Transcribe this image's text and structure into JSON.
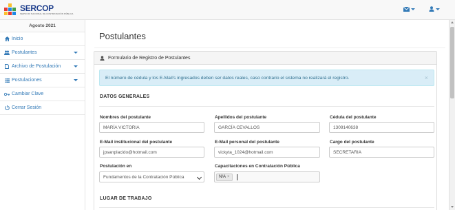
{
  "brand": {
    "title": "SERCOP",
    "subtitle": "SERVICIO NACIONAL DE CONTRATACIÓN PÚBLICA",
    "colors": [
      "#e53935",
      "#fbc02d",
      "#1e88e5",
      "#43a047"
    ]
  },
  "navbar": {
    "mail_icon": "envelope-icon",
    "user_icon": "user-icon"
  },
  "sidebar": {
    "date": "Agosto 2021",
    "items": [
      {
        "label": "Inicio",
        "icon": "home-icon",
        "has_arrow": false
      },
      {
        "label": "Postulantes",
        "icon": "users-icon",
        "has_arrow": true
      },
      {
        "label": "Archivo de Postulación",
        "icon": "file-icon",
        "has_arrow": true
      },
      {
        "label": "Postulaciones",
        "icon": "list-icon",
        "has_arrow": true
      },
      {
        "label": "Cambiar Clave",
        "icon": "key-icon",
        "has_arrow": false
      },
      {
        "label": "Cerrar Sesión",
        "icon": "power-icon",
        "has_arrow": false
      }
    ]
  },
  "main": {
    "title": "Postulantes",
    "panel_title": "Formulario de Registro de Postulantes",
    "alert": "El número de cédula y los E-Mail's ingresados deben ser datos reales, caso contrario el sistema no realizará el registro.",
    "alert_close": "×",
    "section_general": "DATOS GENERALES",
    "section_work": "LUGAR DE TRABAJO",
    "fields": {
      "nombres_label": "Nombres del postulante",
      "nombres_value": "MARÍA VICTORIA",
      "apellidos_label": "Apellidos del postulante",
      "apellidos_value": "GARCÍA CEVALLOS",
      "cedula_label": "Cédula del postulante",
      "cedula_value": "1309140638",
      "email_inst_label": "E-Mail institucional del postulante",
      "email_inst_value": "jpsanplacido@hotmail.com",
      "email_pers_label": "E-Mail personal del postulante",
      "email_pers_value": "vickyta_1024@hotmail.com",
      "cargo_label": "Cargo del postulante",
      "cargo_value": "SECRETARIA",
      "postulacion_label": "Postulación en",
      "postulacion_value": "Fundamentos de la Contratación Pública",
      "capacitaciones_label": "Capacitaciones en Contratación Pública",
      "capacitaciones_tag": "N/A",
      "capacitaciones_tag_remove": "×"
    }
  }
}
